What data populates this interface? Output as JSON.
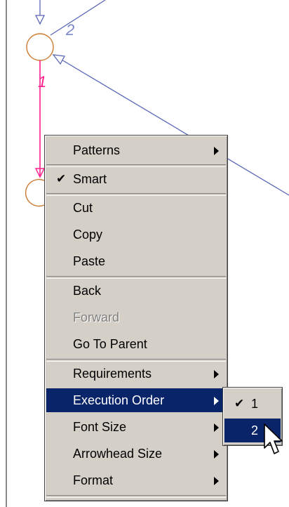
{
  "diagram": {
    "edge_label_2": "2",
    "edge_label_1": "1",
    "colors": {
      "node": "#cc7a2e",
      "edge": "#5a66b8",
      "pink_edge": "#ff1e8c"
    }
  },
  "context_menu": {
    "items": [
      {
        "label": "Patterns",
        "submenu": true
      },
      {
        "label": "Smart",
        "checked": true
      },
      {
        "label": "Cut"
      },
      {
        "label": "Copy"
      },
      {
        "label": "Paste"
      },
      {
        "label": "Back"
      },
      {
        "label": "Forward",
        "disabled": true
      },
      {
        "label": "Go To Parent"
      },
      {
        "label": "Requirements",
        "submenu": true
      },
      {
        "label": "Execution Order",
        "submenu": true,
        "selected": true
      },
      {
        "label": "Font Size",
        "submenu": true
      },
      {
        "label": "Arrowhead Size",
        "submenu": true
      },
      {
        "label": "Format",
        "submenu": true
      }
    ],
    "check_glyph": "✔"
  },
  "execution_order_submenu": {
    "items": [
      {
        "label": "1",
        "checked": true
      },
      {
        "label": "2",
        "selected": true
      }
    ],
    "check_glyph": "✔"
  }
}
